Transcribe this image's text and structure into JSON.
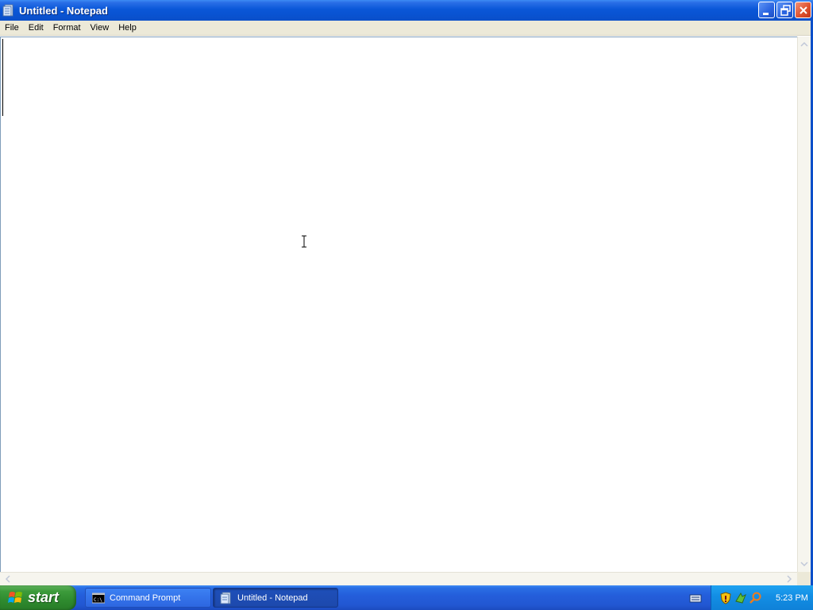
{
  "window": {
    "title": "Untitled - Notepad",
    "icon": "notepad-icon"
  },
  "menu": {
    "items": [
      "File",
      "Edit",
      "Format",
      "View",
      "Help"
    ]
  },
  "editor": {
    "content": ""
  },
  "taskbar": {
    "start_label": "start",
    "tasks": [
      {
        "label": "Command Prompt",
        "icon": "command-prompt-icon",
        "active": false
      },
      {
        "label": "Untitled - Notepad",
        "icon": "notepad-icon",
        "active": true
      }
    ],
    "clock": "5:23 PM",
    "tray_icons": [
      "security-shield-icon",
      "network-icon",
      "search-icon"
    ]
  },
  "colors": {
    "title_bar": "#0a57d8",
    "menu_bg": "#ece9d8",
    "taskbar": "#245edb",
    "start_button": "#3c9a3b",
    "tray": "#138fe5"
  }
}
